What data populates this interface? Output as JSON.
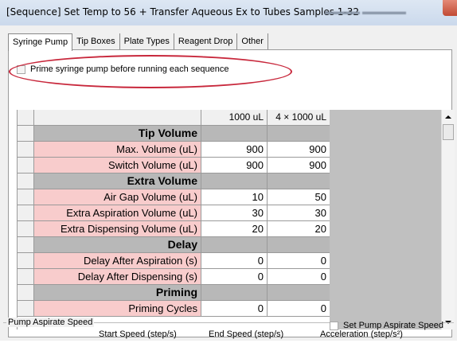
{
  "window": {
    "title": "[Sequence] Set Temp to 56 + Transfer Aqueous Ex to Tubes Samples 1-32"
  },
  "tabs": [
    {
      "label": "Syringe Pump",
      "active": true
    },
    {
      "label": "Tip Boxes"
    },
    {
      "label": "Plate Types"
    },
    {
      "label": "Reagent Drop"
    },
    {
      "label": "Other"
    }
  ],
  "prime": {
    "label": "Prime syringe pump before running each sequence",
    "checked": false
  },
  "grid": {
    "headers": [
      "1000 uL",
      "4 × 1000 uL"
    ],
    "rows": [
      {
        "type": "section",
        "label": "Tip Volume"
      },
      {
        "type": "param",
        "label": "Max. Volume (uL)",
        "v1": "900",
        "v2": "900"
      },
      {
        "type": "param",
        "label": "Switch Volume (uL)",
        "v1": "900",
        "v2": "900"
      },
      {
        "type": "section",
        "label": "Extra Volume"
      },
      {
        "type": "param",
        "label": "Air Gap Volume (uL)",
        "v1": "10",
        "v2": "50"
      },
      {
        "type": "param",
        "label": "Extra Aspiration Volume (uL)",
        "v1": "30",
        "v2": "30"
      },
      {
        "type": "param",
        "label": "Extra Dispensing Volume (uL)",
        "v1": "20",
        "v2": "20"
      },
      {
        "type": "section",
        "label": "Delay"
      },
      {
        "type": "param",
        "label": "Delay After Aspiration (s)",
        "v1": "0",
        "v2": "0"
      },
      {
        "type": "param",
        "label": "Delay After Dispensing (s)",
        "v1": "0",
        "v2": "0"
      },
      {
        "type": "section",
        "label": "Priming"
      },
      {
        "type": "param",
        "label": "Priming Cycles",
        "v1": "0",
        "v2": "0"
      }
    ]
  },
  "pump_speed": {
    "group_label": "Pump Aspirate Speed",
    "start_label": "Start Speed (step/s)",
    "end_label": "End Speed (step/s)",
    "accel_label": "Acceleration (step/s²)",
    "set_label": "Set Pump Aspirate Speed",
    "set_checked": false
  },
  "colors": {
    "section_row": "#b8b8b8",
    "param_label": "#f8cccc",
    "annotation_oval": "#c8283c"
  }
}
